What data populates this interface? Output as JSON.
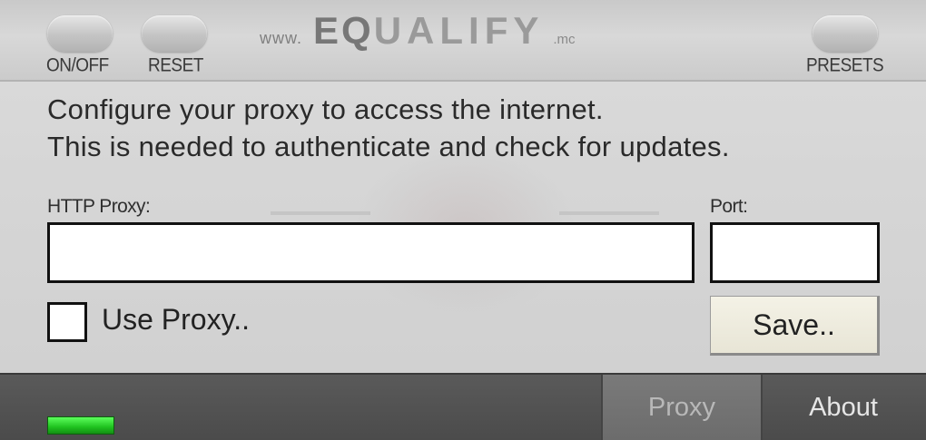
{
  "header": {
    "onoff_label": "ON/OFF",
    "reset_label": "RESET",
    "presets_label": "PRESETS",
    "logo": {
      "prefix": "www.",
      "brand_eq": "EQ",
      "brand_rest": "UALIFY",
      "tld": ".mc"
    }
  },
  "main": {
    "description_line1": "Configure your proxy to access the internet.",
    "description_line2": "This is needed to authenticate and check for updates.",
    "http_proxy_label": "HTTP Proxy:",
    "http_proxy_value": "",
    "port_label": "Port:",
    "port_value": "",
    "use_proxy_label": "Use Proxy..",
    "use_proxy_checked": false,
    "save_label": "Save.."
  },
  "footer": {
    "tabs": [
      {
        "label": "Proxy",
        "active": true
      },
      {
        "label": "About",
        "active": false
      }
    ],
    "status_led_color": "#2fd82f"
  },
  "colors": {
    "background": "#d6d6d6",
    "footer": "#4f4f4f",
    "save_button": "#f0eee0"
  }
}
